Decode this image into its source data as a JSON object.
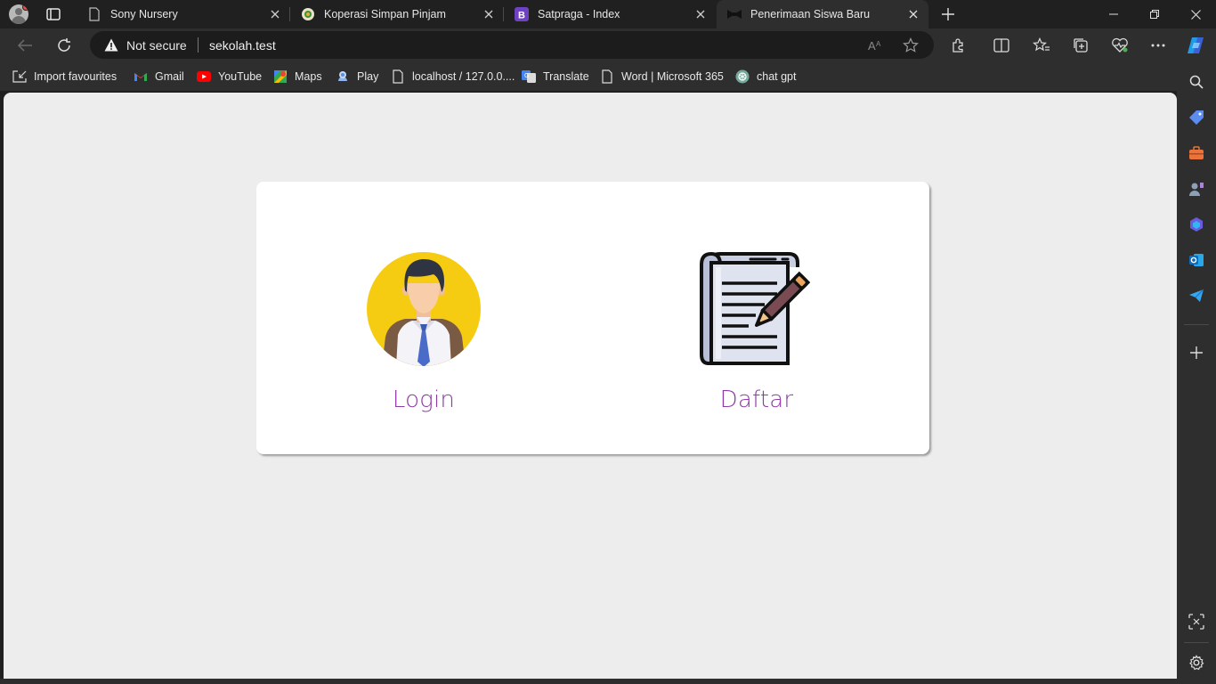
{
  "browser": {
    "tabs": [
      {
        "title": "Sony Nursery",
        "favicon": "page-icon"
      },
      {
        "title": "Koperasi Simpan Pinjam",
        "favicon": "coop-icon"
      },
      {
        "title": "Satpraga - Index",
        "favicon": "bootstrap-icon"
      },
      {
        "title": "Penerimaan Siswa Baru",
        "favicon": "bowtie-icon",
        "active": true
      }
    ],
    "address": {
      "security_label": "Not secure",
      "url": "sekolah.test"
    },
    "bookmarks": [
      {
        "label": "Import favourites",
        "icon": "import-icon"
      },
      {
        "label": "Gmail",
        "icon": "gmail-icon"
      },
      {
        "label": "YouTube",
        "icon": "youtube-icon"
      },
      {
        "label": "Maps",
        "icon": "maps-icon"
      },
      {
        "label": "Play",
        "icon": "play-icon"
      },
      {
        "label": "localhost / 127.0.0....",
        "icon": "page-icon"
      },
      {
        "label": "Translate",
        "icon": "translate-icon"
      },
      {
        "label": "Word | Microsoft 365",
        "icon": "page-icon"
      },
      {
        "label": "chat gpt",
        "icon": "chatgpt-icon"
      }
    ]
  },
  "page": {
    "login_label": "Login",
    "register_label": "Daftar"
  },
  "colors": {
    "label": "#8e3aa6",
    "avatar_bg": "#f6cc12",
    "page_bg": "#ededed"
  }
}
